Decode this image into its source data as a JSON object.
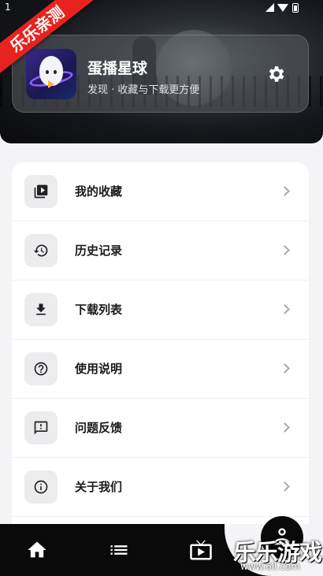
{
  "status_bar": {
    "time": "1"
  },
  "ribbon": {
    "text": "乐乐亲测"
  },
  "profile": {
    "app_name": "蛋播星球",
    "subtitle": "发现 · 收藏与下载更方便",
    "settings_icon": "gear-icon"
  },
  "menu": {
    "items": [
      {
        "label": "我的收藏",
        "icon": "video-library-icon"
      },
      {
        "label": "历史记录",
        "icon": "history-icon"
      },
      {
        "label": "下载列表",
        "icon": "download-icon"
      },
      {
        "label": "使用说明",
        "icon": "help-circle-icon"
      },
      {
        "label": "问题反馈",
        "icon": "feedback-icon"
      },
      {
        "label": "关于我们",
        "icon": "info-icon"
      }
    ]
  },
  "bottom_nav": {
    "items": [
      {
        "icon": "home-icon",
        "active": true
      },
      {
        "icon": "list-icon",
        "active": false
      },
      {
        "icon": "tv-play-icon",
        "active": false
      },
      {
        "icon": "user-icon",
        "active": false
      }
    ]
  },
  "watermark": {
    "text": "乐乐游戏",
    "url": "www.6ll.com"
  },
  "colors": {
    "ribbon": "#e8231f",
    "nav_bg": "#0a0a0a",
    "page_bg": "#f4f4f7"
  }
}
